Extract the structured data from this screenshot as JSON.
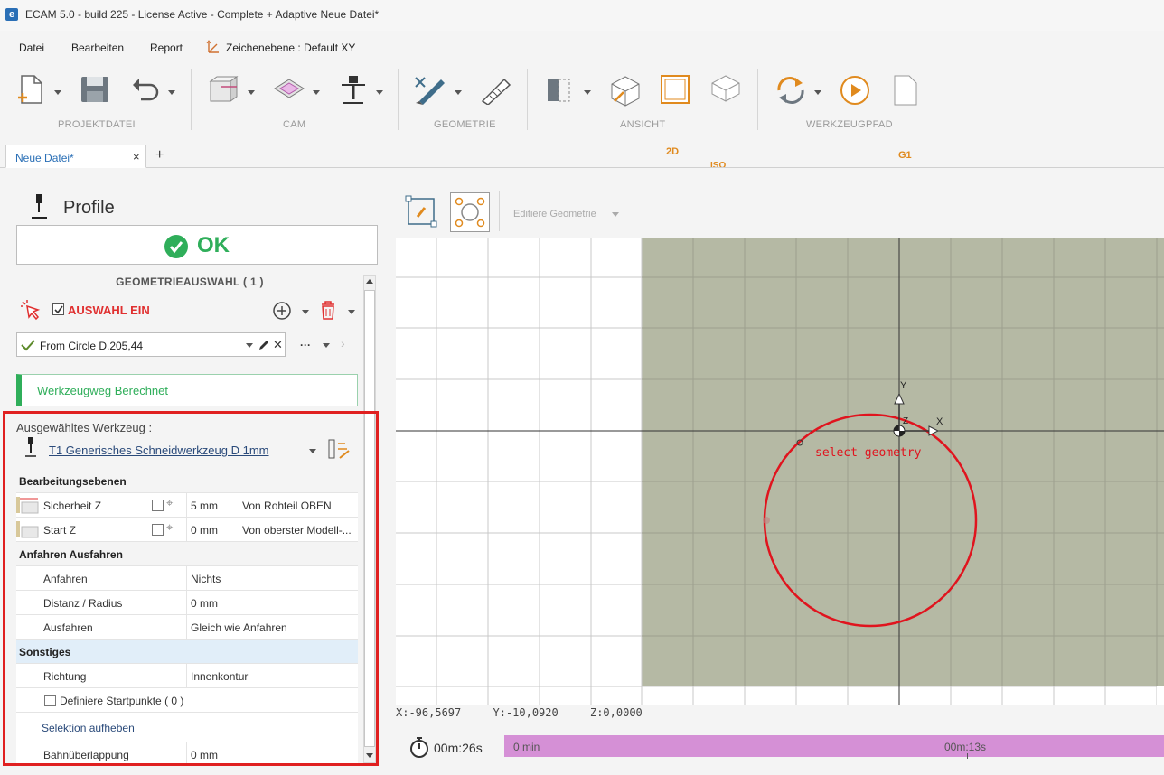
{
  "window": {
    "title": "ECAM 5.0 - build 225 - License Active -  Complete + Adaptive Neue Datei*",
    "app_icon": "e"
  },
  "menu": {
    "items": [
      "Datei",
      "Bearbeiten",
      "Report"
    ],
    "plane_label": "Zeichenebene : Default XY"
  },
  "ribbon": {
    "groups": [
      "PROJEKTDATEI",
      "CAM",
      "GEOMETRIE",
      "ANSICHT",
      "WERKZEUGPFAD"
    ],
    "icons": {
      "new_file": "new-file-icon",
      "save": "save-icon",
      "undo": "undo-icon",
      "stock": "stock-icon",
      "pocket": "pocket-icon",
      "tool": "tool-icon",
      "edit_geometry": "edit-geometry-icon",
      "measure": "measure-icon",
      "view_toggle": "view-toggle-icon",
      "view_3d": "view-3d-icon",
      "view_2d": "view-2d-icon",
      "view_iso": "view-iso-icon",
      "regenerate": "regenerate-icon",
      "simulate": "play-icon",
      "gcode": "gcode-icon"
    },
    "badges": {
      "two_d": "2D",
      "iso": "ISO",
      "gcode": "G1"
    }
  },
  "tabs": {
    "document": "Neue Datei*",
    "close": "×",
    "add": "+"
  },
  "panel": {
    "title": "Profile",
    "ok_label": "OK",
    "geometry_header": "GEOMETRIEAUSWAHL ( 1 )",
    "selection_label": "AUSWAHL EIN",
    "selection_checked": true,
    "geometry_item": "From Circle D.205,44",
    "more": "···",
    "status": "Werkzeugweg Berechnet",
    "tool_section": "Ausgewähltes Werkzeug :",
    "tool_name": "T1 Generisches Schneidwerkzeug D 1mm",
    "properties": {
      "section_planes": "Bearbeitungsebenen",
      "safety_label": "Sicherheit Z",
      "safety_value": "5 mm",
      "safety_ref": "Von Rohteil OBEN",
      "start_label": "Start Z",
      "start_value": "0 mm",
      "start_ref": "Von oberster Modell-...",
      "section_approach": "Anfahren Ausfahren",
      "approach_label": "Anfahren",
      "approach_value": "Nichts",
      "distance_label": "Distanz / Radius",
      "distance_value": "0 mm",
      "exit_label": "Ausfahren",
      "exit_value": "Gleich wie Anfahren",
      "section_misc": "Sonstiges",
      "direction_label": "Richtung",
      "direction_value": "Innenkontur",
      "startpoints_label": "Definiere Startpunkte ( 0 )",
      "clear_selection": "Selektion aufheben",
      "overlap_label": "Bahnüberlappung",
      "overlap_value": "0 mm"
    }
  },
  "viewport": {
    "toolbar_label": "Editiere Geometrie",
    "hint": "select geometry",
    "axis_x": "X",
    "axis_y": "Y",
    "axis_z": "Z",
    "coords": {
      "x": "X:-96,5697",
      "y": "Y:-10,0920",
      "z": "Z:0,0000"
    },
    "colors": {
      "stock": "#b5b9a4",
      "circle": "#e0141e",
      "grid": "#c8c8c8"
    }
  },
  "timeline": {
    "total": "00m:26s",
    "start": "0 min",
    "mark": "00m:13s",
    "color": "#d590d6"
  }
}
